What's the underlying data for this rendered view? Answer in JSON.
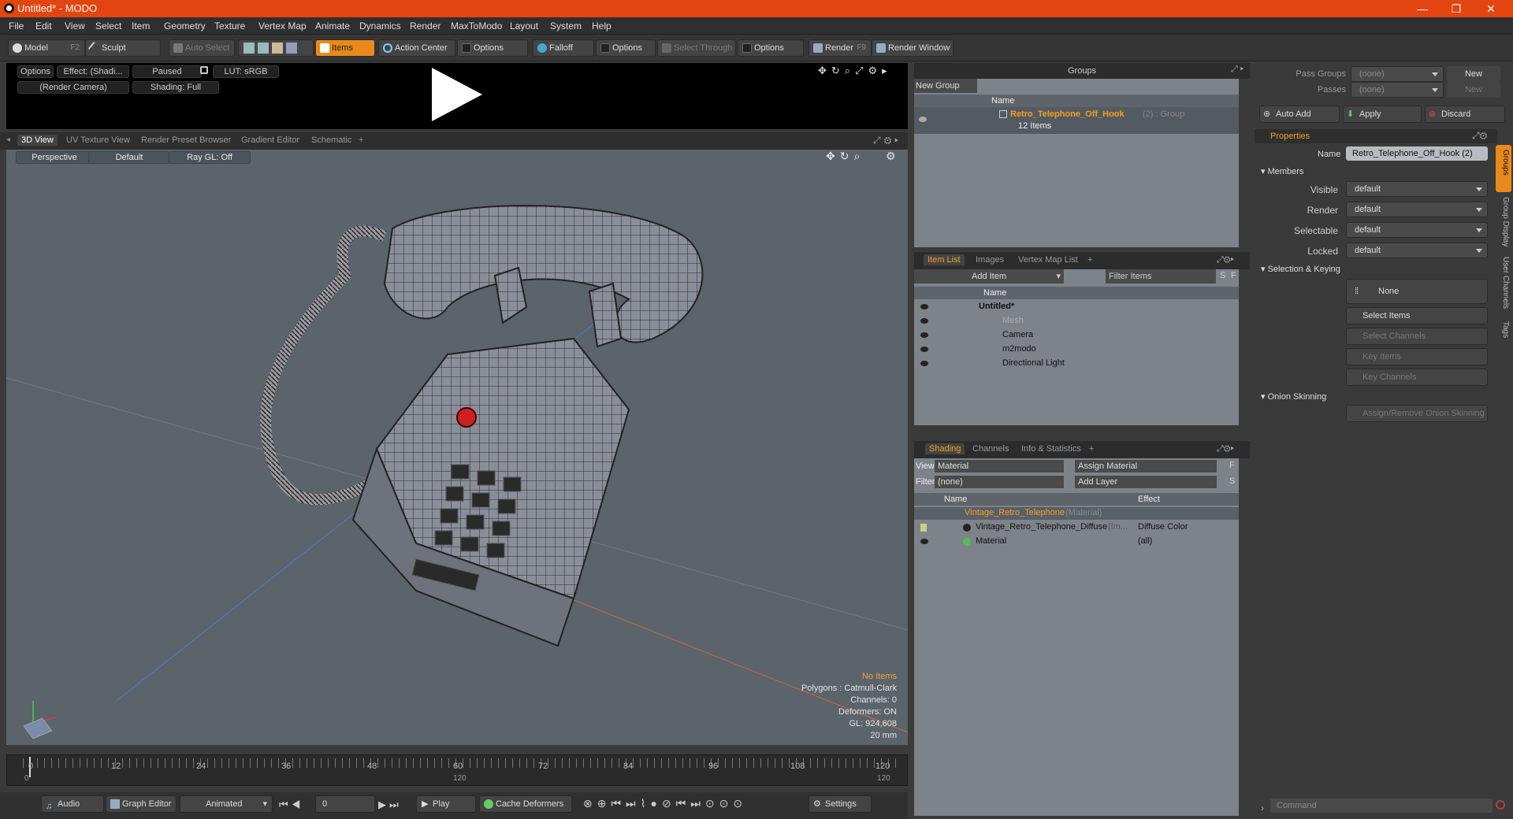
{
  "window": {
    "title": "Untitled* - MODO"
  },
  "menu": [
    "File",
    "Edit",
    "View",
    "Select",
    "Item",
    "Geometry",
    "Texture",
    "Vertex Map",
    "Animate",
    "Dynamics",
    "Render",
    "MaxToModo",
    "Layout",
    "System",
    "Help"
  ],
  "toolbar": {
    "model": "Model",
    "model_key": "F2",
    "sculpt": "Sculpt",
    "auto_select": "Auto Select",
    "items": "Items",
    "action_center": "Action Center",
    "options1": "Options",
    "falloff": "Falloff",
    "options2": "Options",
    "select_through": "Select Through",
    "options3": "Options",
    "render": "Render",
    "render_key": "F9",
    "render_window": "Render Window"
  },
  "preview": {
    "options": "Options",
    "effect": "Effect: (Shadi...",
    "paused": "Paused",
    "lut": "LUT: sRGB",
    "camera": "(Render Camera)",
    "shading": "Shading: Full"
  },
  "view_tabs": [
    "3D View",
    "UV Texture View",
    "Render Preset Browser",
    "Gradient Editor",
    "Schematic",
    "+"
  ],
  "viewport": {
    "perspective": "Perspective",
    "default": "Default",
    "raygl": "Ray GL: Off",
    "info": {
      "no_items": "No Items",
      "polygons": "Polygons : Catmull-Clark",
      "channels": "Channels: 0",
      "deformers": "Deformers: ON",
      "gl": "GL: 924,608",
      "unit": "20 mm"
    }
  },
  "timeline": {
    "ticks": [
      "0",
      "12",
      "24",
      "36",
      "48",
      "60",
      "72",
      "84",
      "96",
      "108",
      "120"
    ],
    "sub_start": "0",
    "sub_mid": "120",
    "sub_end": "120"
  },
  "bottom": {
    "audio": "Audio",
    "graph_editor": "Graph Editor",
    "animated": "Animated",
    "frame": "0",
    "play": "Play",
    "cache": "Cache Deformers",
    "settings": "Settings"
  },
  "groups": {
    "title": "Groups",
    "new_group": "New Group",
    "col_name": "Name",
    "group_name": "Retro_Telephone_Off_Hook",
    "group_suffix": "(2) : Group",
    "group_count": "12 Items"
  },
  "itemlist": {
    "tabs": [
      "Item List",
      "Images",
      "Vertex Map List",
      "+"
    ],
    "add_item": "Add Item",
    "filter": "Filter Items",
    "s": "S",
    "f": "F",
    "col_name": "Name",
    "items": [
      "Untitled*",
      "Mesh",
      "Camera",
      "m2modo",
      "Directional Light"
    ]
  },
  "shading": {
    "tabs": [
      "Shading",
      "Channels",
      "Info & Statistics",
      "+"
    ],
    "view_label": "View",
    "view_value": "Material",
    "assign": "Assign Material",
    "f": "F",
    "filter_label": "Filter",
    "filter_value": "(none)",
    "add_layer": "Add Layer",
    "s": "S",
    "col_name": "Name",
    "col_effect": "Effect",
    "rows": [
      {
        "name": "Vintage_Retro_Telephone",
        "suffix": "(Material)",
        "effect": ""
      },
      {
        "name": "Vintage_Retro_Telephone_Diffuse",
        "suffix": "(Im...",
        "effect": "Diffuse Color"
      },
      {
        "name": "Material",
        "suffix": "",
        "effect": "(all)"
      }
    ]
  },
  "right": {
    "pass_groups": "Pass Groups",
    "pass_none": "(none)",
    "new1": "New",
    "passes": "Passes",
    "passes_none": "(none)",
    "new2": "New",
    "auto_add": "Auto Add",
    "apply": "Apply",
    "discard": "Discard",
    "properties": "Properties",
    "name_label": "Name",
    "name_value": "Retro_Telephone_Off_Hook (2)",
    "members": "Members",
    "visible": "Visible",
    "render": "Render",
    "selectable": "Selectable",
    "locked": "Locked",
    "default": "default",
    "sel_keying": "Selection & Keying",
    "none": "None",
    "select_items": "Select Items",
    "select_channels": "Select Channels",
    "key_items": "Key Items",
    "key_channels": "Key Channels",
    "onion": "Onion Skinning",
    "assign_onion": "Assign/Remove Onion Skinning",
    "side_tabs": [
      "Groups",
      "Group Display",
      "User Channels",
      "Tags"
    ],
    "command": "Command"
  }
}
